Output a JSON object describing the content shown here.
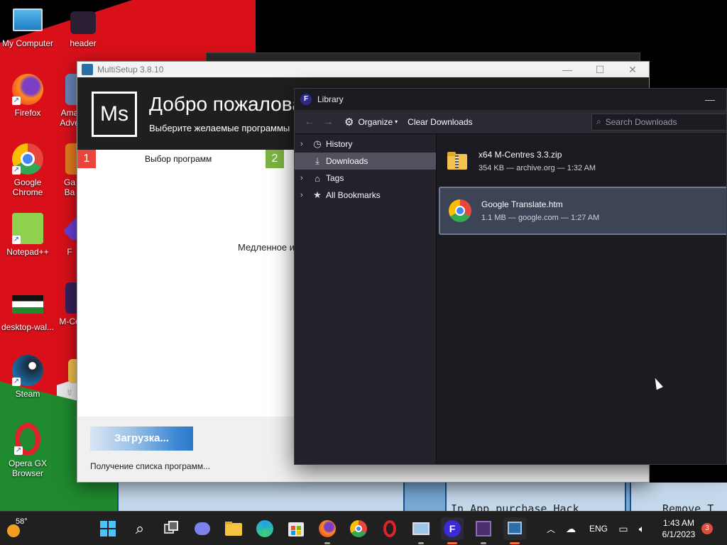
{
  "desktop": {
    "icons": [
      {
        "label": "My Computer"
      },
      {
        "label": "header"
      },
      {
        "label": "Firefox"
      },
      {
        "label": "Ama\nAdve"
      },
      {
        "label": "Google\nChrome"
      },
      {
        "label": "Ga\nBa"
      },
      {
        "label": "Notepad++"
      },
      {
        "label": "F"
      },
      {
        "label": "desktop-wal..."
      },
      {
        "label": "M-Ce"
      },
      {
        "label": "Steam"
      },
      {
        "label": "t"
      },
      {
        "label": "Opera GX\nBrowser"
      }
    ],
    "wallpaper_text": [
      "In App purchase Hack",
      "Remove T"
    ]
  },
  "multisetup": {
    "title": "MultiSetup 3.8.10",
    "logo": "Ms",
    "welcome": "Добро пожаловать",
    "subtitle": "Выберите желаемые программы",
    "steps": [
      {
        "num": "1",
        "label": "Выбор программ",
        "color": "#e8453c"
      },
      {
        "num": "2",
        "label": "",
        "color": "#7cb342"
      }
    ],
    "slow_text": "Медленное и",
    "load_button": "Загрузка...",
    "status": "Получение списка программ..."
  },
  "library": {
    "title": "Library",
    "toolbar": {
      "organize": "Organize",
      "clear": "Clear Downloads",
      "search_placeholder": "Search Downloads"
    },
    "sidebar": [
      {
        "label": "History",
        "icon": "clock-icon",
        "selected": false
      },
      {
        "label": "Downloads",
        "icon": "download-icon",
        "selected": true
      },
      {
        "label": "Tags",
        "icon": "tag-icon",
        "selected": false
      },
      {
        "label": "All Bookmarks",
        "icon": "star-icon",
        "selected": false
      }
    ],
    "downloads": [
      {
        "name": "x64 M-Centres 3.3.zip",
        "meta": "354 KB — archive.org — 1:32 AM",
        "icon": "zip-folder-icon"
      },
      {
        "name": "Google Translate.htm",
        "meta": "1.1 MB — google.com — 1:27 AM",
        "icon": "chrome-icon"
      }
    ]
  },
  "taskbar": {
    "weather_temp": "58°",
    "apps": [
      "start",
      "search",
      "task-view",
      "teams",
      "file-explorer",
      "edge",
      "store",
      "firefox",
      "chrome",
      "opera",
      "photos",
      "firefox-nightly",
      "m-centres",
      "multisetup"
    ],
    "lang": "ENG",
    "time": "1:43 AM",
    "date": "6/1/2023",
    "notifications": "3"
  }
}
